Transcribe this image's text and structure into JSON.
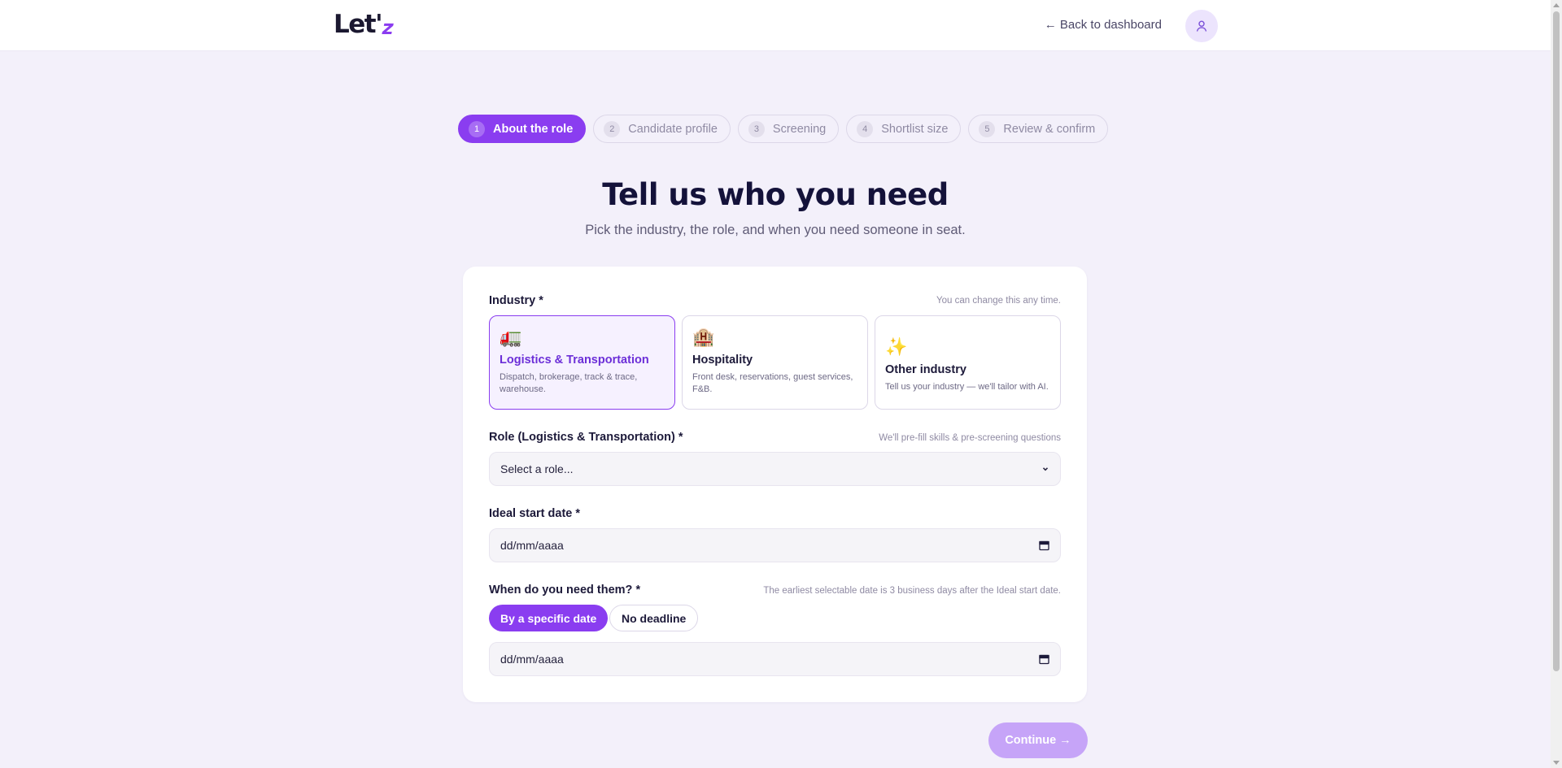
{
  "header": {
    "logo_main": "Let'",
    "logo_accent": "z",
    "back_link": "← Back to dashboard",
    "avatar_icon": "user-icon"
  },
  "stepper": {
    "steps": [
      {
        "num": "1",
        "label": "About the role",
        "active": true
      },
      {
        "num": "2",
        "label": "Candidate profile",
        "active": false
      },
      {
        "num": "3",
        "label": "Screening",
        "active": false
      },
      {
        "num": "4",
        "label": "Shortlist size",
        "active": false
      },
      {
        "num": "5",
        "label": "Review & confirm",
        "active": false
      }
    ]
  },
  "page": {
    "title": "Tell us who you need",
    "subtitle": "Pick the industry, the role, and when you need someone in seat."
  },
  "form": {
    "industry": {
      "label": "Industry *",
      "hint": "You can change this any time.",
      "options": [
        {
          "emoji": "🚛",
          "icon": "truck-icon",
          "name": "Logistics & Transportation",
          "desc": "Dispatch, brokerage, track & trace, warehouse.",
          "selected": true
        },
        {
          "emoji": "🏨",
          "icon": "hotel-icon",
          "name": "Hospitality",
          "desc": "Front desk, reservations, guest services, F&B.",
          "selected": false
        },
        {
          "emoji": "✨",
          "icon": "sparkles-icon",
          "name": "Other industry",
          "desc": "Tell us your industry — we'll tailor with AI.",
          "selected": false
        }
      ]
    },
    "role": {
      "label": "Role (Logistics & Transportation) *",
      "hint": "We'll pre-fill skills & pre-screening questions",
      "value": "Select a role..."
    },
    "start_date": {
      "label": "Ideal start date *",
      "value": "dd/mm/aaaa"
    },
    "need_by": {
      "label": "When do you need them? *",
      "hint": "The earliest selectable date is 3 business days after the Ideal start date.",
      "options": [
        "By a specific date",
        "No deadline"
      ],
      "selected": "By a specific date",
      "date_value": "dd/mm/aaaa"
    }
  },
  "actions": {
    "continue_label": "Continue →"
  },
  "colors": {
    "accent": "#8a3df0",
    "background": "#f3f0fa",
    "continue_disabled": "#c6a4f8"
  }
}
